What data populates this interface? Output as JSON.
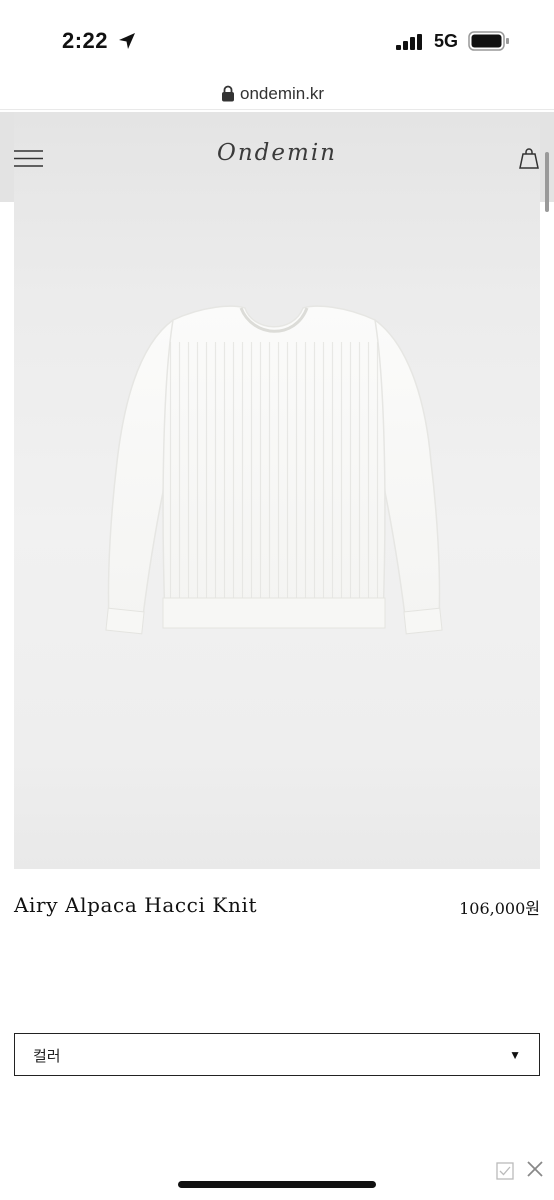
{
  "status_bar": {
    "time": "2:22",
    "network": "5G"
  },
  "browser": {
    "url": "ondemin.kr"
  },
  "header": {
    "logo": "Ondemin",
    "menu_icon": "hamburger-menu-icon",
    "cart_icon": "shopping-bag-icon"
  },
  "product": {
    "image": "white alpaca knit sweater",
    "name": "Airy Alpaca Hacci Knit",
    "price": "106,000원"
  },
  "options": {
    "color_label": "컬러",
    "caret": "▼"
  },
  "colors": {
    "hero_bg": "#ececec",
    "text": "#111111"
  }
}
